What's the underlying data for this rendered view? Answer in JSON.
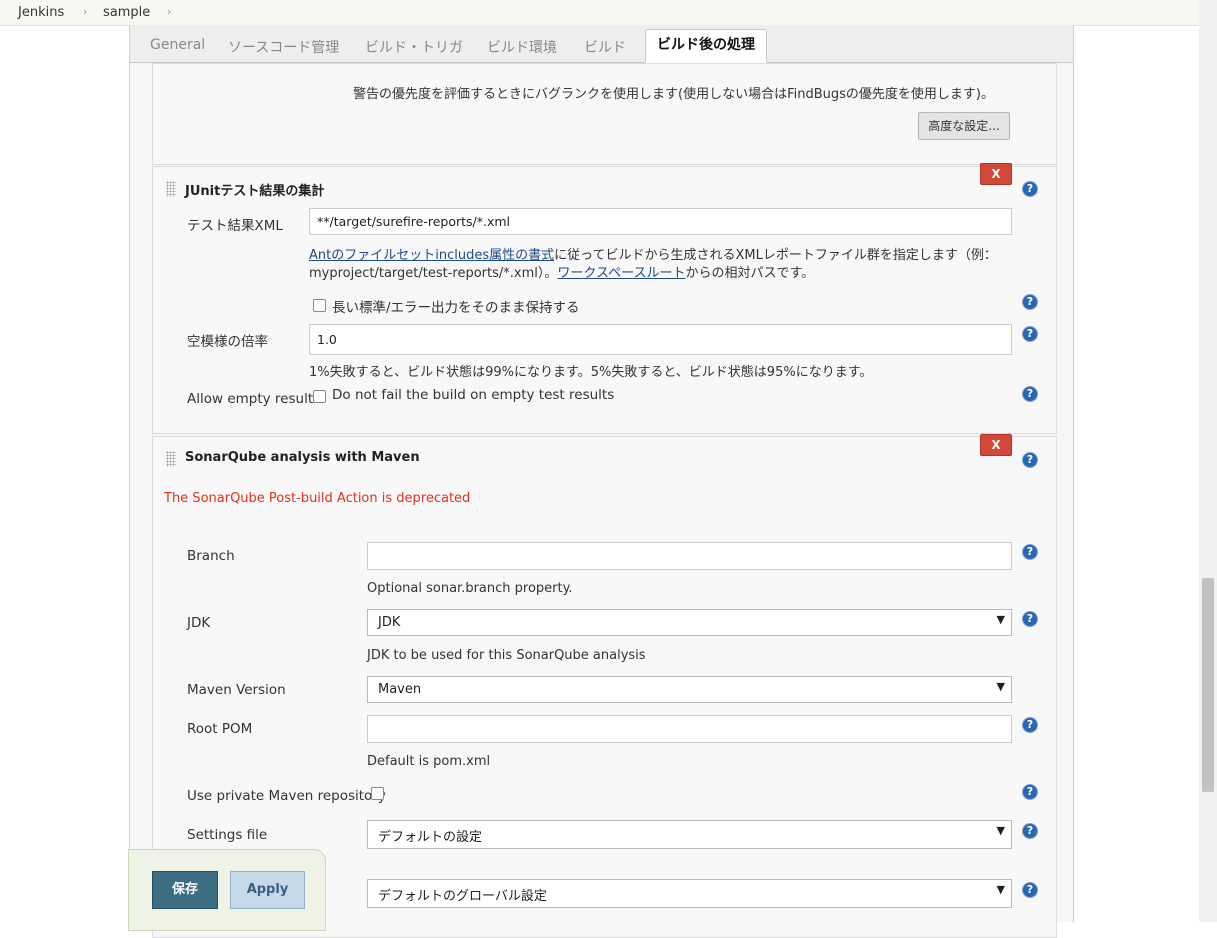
{
  "breadcrumb": {
    "root": "Jenkins",
    "item": "sample",
    "sep": "›"
  },
  "tabs": [
    "General",
    "ソースコード管理",
    "ビルド・トリガ",
    "ビルド環境",
    "ビルド",
    "ビルド後の処理"
  ],
  "top_section": {
    "description": "警告の優先度を評価するときにバグランクを使用します(使用しない場合はFindBugsの優先度を使用します)。",
    "advanced_button": "高度な設定..."
  },
  "junit": {
    "title": "JUnitテスト結果の集計",
    "delete_label": "X",
    "xml_label": "テスト結果XML",
    "xml_value": "**/target/surefire-reports/*.xml",
    "desc_link1": "Antのファイルセットincludes属性の書式",
    "desc_part1": "に従ってビルドから生成されるXMLレポートファイル群を指定します（例：",
    "desc_part2": "myproject/target/test-reports/*.xml）。",
    "desc_link2": "ワークスペースルート",
    "desc_part3": "からの相対パスです。",
    "keep_output_label": "長い標準/エラー出力をそのまま保持する",
    "health_label": "空模様の倍率",
    "health_value": "1.0",
    "health_desc": "1%失敗すると、ビルド状態は99%になります。5%失敗すると、ビルド状態は95%になります。",
    "allow_empty_label": "Allow empty results",
    "allow_empty_check": "Do not fail the build on empty test results"
  },
  "sonar": {
    "title": "SonarQube analysis with Maven",
    "delete_label": "X",
    "deprecated": "The SonarQube Post-build Action is deprecated",
    "branch_label": "Branch",
    "branch_value": "",
    "branch_desc": "Optional sonar.branch property.",
    "jdk_label": "JDK",
    "jdk_value": "JDK",
    "jdk_desc": "JDK to be used for this SonarQube analysis",
    "maven_label": "Maven Version",
    "maven_value": "Maven",
    "rootpom_label": "Root POM",
    "rootpom_value": "",
    "rootpom_desc": "Default is pom.xml",
    "private_repo_label": "Use private Maven repository",
    "settings_label": "Settings file",
    "settings_value": "デフォルトの設定",
    "global_settings_value": "デフォルトのグローバル設定"
  },
  "help_glyph": "?",
  "dropdown_arrow": "▼",
  "buttons": {
    "save": "保存",
    "apply": "Apply"
  },
  "colors": {
    "delete": "#d24939",
    "deprecated": "#e0321c",
    "link": "#204a87",
    "save": "#3b6e81",
    "apply": "#c5d9ea",
    "help": "#2a67b1"
  }
}
